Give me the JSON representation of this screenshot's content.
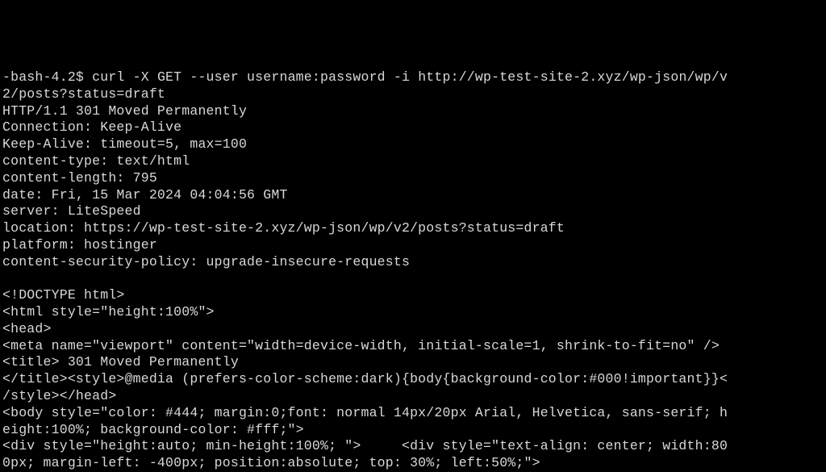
{
  "terminal": {
    "prompt": "-bash-4.2$ ",
    "command": "curl -X GET --user username:password -i http://wp-test-site-2.xyz/wp-json/wp/v\n2/posts?status=draft",
    "response_lines": [
      "HTTP/1.1 301 Moved Permanently",
      "Connection: Keep-Alive",
      "Keep-Alive: timeout=5, max=100",
      "content-type: text/html",
      "content-length: 795",
      "date: Fri, 15 Mar 2024 04:04:56 GMT",
      "server: LiteSpeed",
      "location: https://wp-test-site-2.xyz/wp-json/wp/v2/posts?status=draft",
      "platform: hostinger",
      "content-security-policy: upgrade-insecure-requests",
      "",
      "<!DOCTYPE html>",
      "<html style=\"height:100%\">",
      "<head>",
      "<meta name=\"viewport\" content=\"width=device-width, initial-scale=1, shrink-to-fit=no\" />",
      "<title> 301 Moved Permanently",
      "</title><style>@media (prefers-color-scheme:dark){body{background-color:#000!important}}<",
      "/style></head>",
      "<body style=\"color: #444; margin:0;font: normal 14px/20px Arial, Helvetica, sans-serif; h",
      "eight:100%; background-color: #fff;\">",
      "<div style=\"height:auto; min-height:100%; \">     <div style=\"text-align: center; width:80",
      "0px; margin-left: -400px; position:absolute; top: 30%; left:50%;\">"
    ]
  }
}
